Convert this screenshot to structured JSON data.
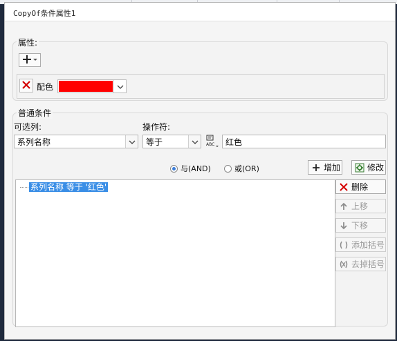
{
  "dialog": {
    "title": "CopyOf条件属性1"
  },
  "properties": {
    "group_label": "属性:",
    "add_icon": "plus-icon",
    "row": {
      "remove_icon": "red-x-icon",
      "label": "配色",
      "color": "#ff0000"
    }
  },
  "conditions": {
    "group_label": "普通条件",
    "column_label": "可选列:",
    "column_value": "系列名称",
    "operator_label": "操作符:",
    "operator_value": "等于",
    "value_type_icon": "abc-formula-icon",
    "value": "红色",
    "radio_and": "与(AND)",
    "radio_or": "或(OR)",
    "selected_logic": "AND",
    "add_button": "增加",
    "modify_button": "修改",
    "list": [
      "系列名称 等于 '红色'"
    ],
    "side_buttons": {
      "delete": "删除",
      "move_up": "上移",
      "move_down": "下移",
      "add_bracket": "添加括号",
      "remove_bracket": "去掉括号"
    }
  }
}
